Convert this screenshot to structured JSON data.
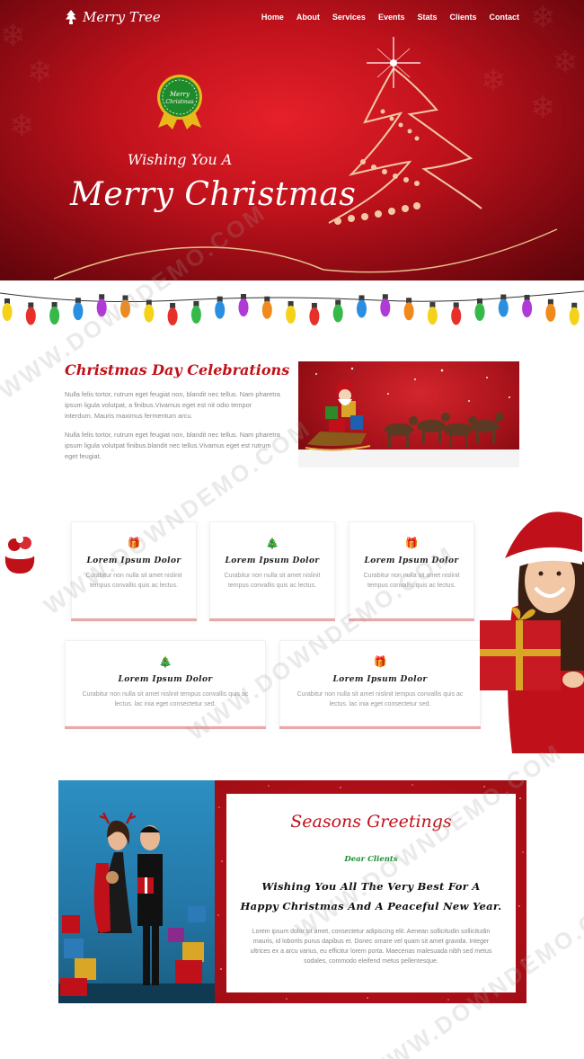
{
  "brand": {
    "name": "Merry Tree"
  },
  "nav": {
    "items": [
      "Home",
      "About",
      "Services",
      "Events",
      "Stats",
      "Clients",
      "Contact"
    ]
  },
  "hero": {
    "badge_line1": "Merry",
    "badge_line2": "Christmas",
    "wish": "Wishing You A",
    "headline": "Merry Christmas"
  },
  "about": {
    "title": "Christmas Day Celebrations",
    "p1": "Nulla felis tortor, rutrum eget feugiat non, blandit nec tellus. Nam pharetra ipsum ligula volutpat, a finibus.Vivamus eget est nit odio tempor interdum. Mauris maximus fermentum arcu.",
    "p2": "Nulla felis tortor, rutrum eget feugiat non, blandit nec tellus. Nam pharetra ipsum ligula volutpat finibus.blandit nec tellus.Vivamus eget est rutrum eget feugiat."
  },
  "services": [
    {
      "icon": "gift-icon",
      "title": "Lorem Ipsum Dolor",
      "text": "Curabitur non nulla sit amet nislinit tempus convallis quis ac lectus."
    },
    {
      "icon": "tree-icon",
      "title": "Lorem Ipsum Dolor",
      "text": "Curabitur non nulla sit amet nislinit tempus convallis quis ac lectus."
    },
    {
      "icon": "gift-icon",
      "title": "Lorem Ipsum Dolor",
      "text": "Curabitur non nulla sit amet nislinit tempus convallis quis ac lectus."
    },
    {
      "icon": "tree-icon",
      "title": "Lorem Ipsum Dolor",
      "text": "Curabitur non nulla sit amet nislinit tempus convallis quis ac lectus. lac inia eget consectetur sed."
    },
    {
      "icon": "gift-icon",
      "title": "Lorem Ipsum Dolor",
      "text": "Curabitur non nulla sit amet nislinit tempus convallis quis ac lectus. lac inia eget consectetur sed."
    }
  ],
  "greetings": {
    "title": "Seasons Greetings",
    "sub": "Dear Clients",
    "message_line1": "Wishing You All The Very Best For A",
    "message_line2": "Happy Christmas And A Peaceful New Year.",
    "body": "Lorem ipsum dolor sit amet, consectetur adipiscing elit. Aenean sollicitudin sollicitudin mauris, id lobortis purus dapibus et. Donec ornare vel quam sit amet gravida. Integer ultrices ex a arcu varius, eu efficitur lorem porta. Maecenas malesuada nibh sed metus sodales, commodo eleifend metus pellentesque."
  },
  "watermark": "WWW.DOWNDEMO.COM",
  "colors": {
    "brand_red": "#c0111a",
    "green": "#1c8b2f",
    "pink_shadow": "#e9a7a7"
  }
}
